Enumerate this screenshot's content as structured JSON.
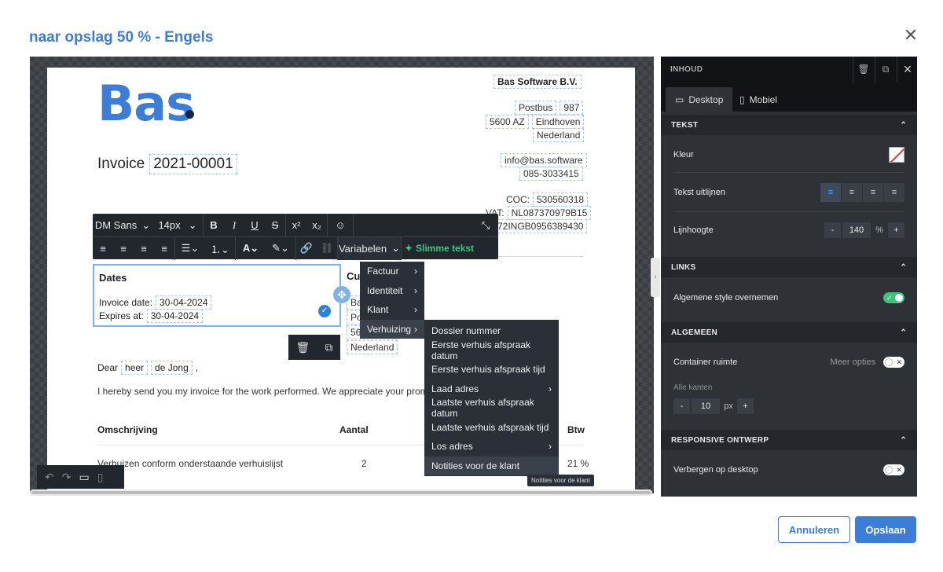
{
  "dialog": {
    "title": "naar opslag 50 % - Engels"
  },
  "document": {
    "logo_text": "Bas",
    "invoice_label": "Invoice",
    "invoice_number": "2021-00001",
    "company": {
      "name": "Bas Software B.V.",
      "postbus_label": "Postbus",
      "postbus_number": "987",
      "postcode": "5600 AZ",
      "city": "Eindhoven",
      "country": "Nederland",
      "email": "info@bas.software",
      "phone": "085-3033415",
      "coc_label": "COC:",
      "coc": "53056031​8",
      "vat_label": "VAT:",
      "vat": "NL087370979B15",
      "iban": "72INGB0956389430"
    },
    "dates": {
      "title": "Dates",
      "invoice_date_label": "Invoice date:",
      "invoice_date": "30-04-2024",
      "expires_label": "Expires at:",
      "expires": "30-04-2024"
    },
    "customer": {
      "title": "Cu",
      "line1": "Ba",
      "line2": "Po",
      "line3": "56",
      "country": "Nederland"
    },
    "greeting": {
      "dear": "Dear",
      "salutation": "heer",
      "name": "de Jong",
      "comma": ","
    },
    "intro": "I hereby send you my invoice for the work performed. We appreciate your prompt p",
    "table": {
      "headers": [
        "Omschrijving",
        "Aantal",
        "Btw"
      ],
      "rows": [
        [
          "Verhuizen conform onderstaande verhuislijst",
          "2",
          "21 %"
        ]
      ]
    }
  },
  "toolbar": {
    "font": "DM Sans",
    "size": "14px",
    "variables_label": "Variabelen",
    "smart_text_label": "Slimme tekst"
  },
  "variables_menu": {
    "items": [
      "Factuur",
      "Identiteit",
      "Klant",
      "Verhuizing"
    ],
    "submenu": [
      "Dossier nummer",
      "Eerste verhuis afspraak datum",
      "Eerste verhuis afspraak tijd",
      "Laad adres",
      "Laatste verhuis afspraak datum",
      "Laatste verhuis afspraak tijd",
      "Los adres",
      "Notities voor de klant"
    ]
  },
  "tooltip": "Notities voor de klant",
  "panel": {
    "header": "INHOUD",
    "tab_desktop": "Desktop",
    "tab_mobile": "Mobiel",
    "tekst": {
      "title": "TEKST",
      "color_label": "Kleur",
      "align_label": "Tekst uitlijnen",
      "line_height_label": "Lijnhoogte",
      "line_height_value": "140",
      "line_height_unit": "%"
    },
    "links": {
      "title": "LINKS",
      "inherit_label": "Algemene style overnemen",
      "inherit_on": true
    },
    "algemeen": {
      "title": "ALGEMEEN",
      "container_label": "Container ruimte",
      "more_label": "Meer opties",
      "all_sides_label": "Alle kanten",
      "padding_value": "10",
      "padding_unit": "px"
    },
    "responsive": {
      "title": "RESPONSIVE ONTWERP",
      "hide_desktop_label": "Verbergen op desktop"
    }
  },
  "footer": {
    "cancel": "Annuleren",
    "save": "Opslaan"
  }
}
